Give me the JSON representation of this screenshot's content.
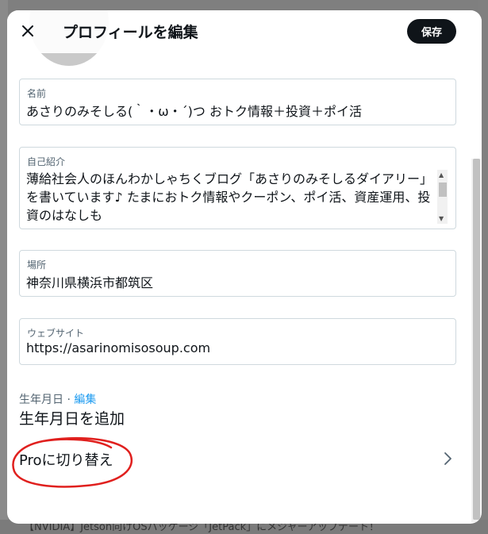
{
  "modal": {
    "title": "プロフィールを編集",
    "save_label": "保存",
    "close_icon": "close-icon"
  },
  "fields": {
    "name": {
      "label": "名前",
      "value": "あさりのみそしる(｀・ω・´)つ おトク情報＋投資＋ポイ活"
    },
    "bio": {
      "label": "自己紹介",
      "value": "薄給社会人のほんわかしゃちくブログ「あさりのみそしるダイアリー」を書いています♪ たまにおトク情報やクーポン、ポイ活、資産運用、投資のはなしも"
    },
    "location": {
      "label": "場所",
      "value": "神奈川県横浜市都筑区"
    },
    "website": {
      "label": "ウェブサイト",
      "value": "https://asarinomisosoup.com"
    }
  },
  "birthdate": {
    "label": "生年月日",
    "separator": " · ",
    "edit_label": "編集",
    "value": "生年月日を追加"
  },
  "pro": {
    "label": "Proに切り替え"
  },
  "background": {
    "bottom_text": "【NVIDIA】Jetson向けOSパッケージ「JetPack」にメジャーアップデート！"
  },
  "colors": {
    "accent": "#1d9bf0",
    "primary_text": "#0f1419",
    "secondary_text": "#536471",
    "annotation": "#e0201e"
  }
}
